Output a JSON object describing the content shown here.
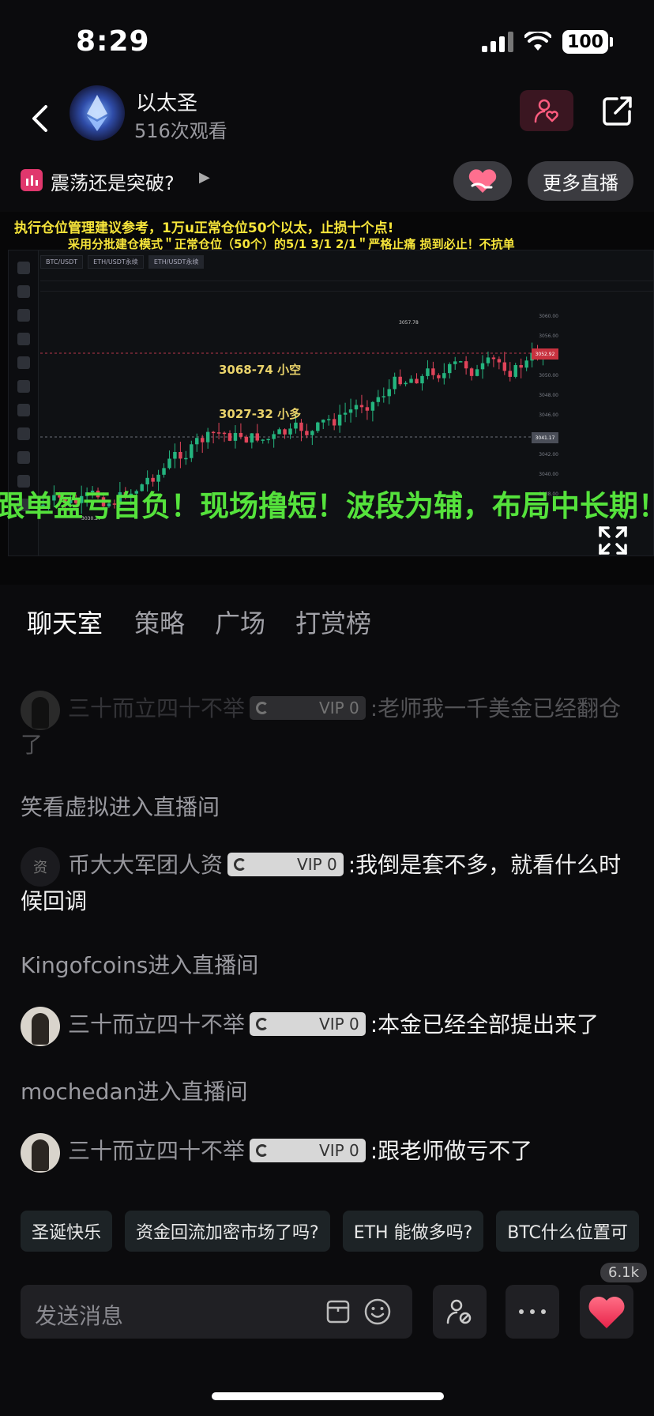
{
  "status": {
    "time": "8:29",
    "battery": "100"
  },
  "header": {
    "title": "以太圣",
    "views": "516次观看"
  },
  "topic": {
    "text": "震荡还是突破?"
  },
  "buttons": {
    "more_live": "更多直播"
  },
  "video": {
    "banner_line1": "执行仓位管理建议参考，1万u正常仓位50个以太，止损十个点!",
    "banner_line2": "采用分批建仓模式＂正常仓位（50个）的5/1   3/1   2/1＂严格止痛 损到必止！不抗单",
    "pairs": [
      "BTC/USDT",
      "ETH/USDT永续",
      "ETH/USDT永续"
    ],
    "label_short": "3068-74 小空",
    "label_long": "3027-32 小多",
    "peak": "3057.78",
    "low": "3030.27",
    "price_tag_red": "3052.92",
    "price_tag_grey": "3041.17",
    "marquee": "跟单盈亏自负！现场撸短！波段为辅，布局中长期！"
  },
  "tabs": [
    "聊天室",
    "策略",
    "广场",
    "打赏榜"
  ],
  "chat": [
    {
      "user": "三十而立四十不举",
      "vip": "VIP 0",
      "text": ":老师我一千美金已经翻仓了",
      "faded": true
    },
    {
      "system": "笑看虚拟进入直播间"
    },
    {
      "user": "币大大军团人资",
      "vip": "VIP 0",
      "text": ":我倒是套不多，就看什么时候回调",
      "avatar_text": "资"
    },
    {
      "system": "Kingofcoins进入直播间"
    },
    {
      "user": "三十而立四十不举",
      "vip": "VIP 0",
      "text": ":本金已经全部提出来了"
    },
    {
      "system": "mochedan进入直播间"
    },
    {
      "user": "三十而立四十不举",
      "vip": "VIP 0",
      "text": ":跟老师做亏不了"
    }
  ],
  "quick_replies": [
    "圣诞快乐",
    "资金回流加密市场了吗?",
    "ETH 能做多吗?",
    "BTC什么位置可"
  ],
  "input": {
    "placeholder": "发送消息"
  },
  "likes": "6.1k",
  "colors": {
    "accent": "#e8345f",
    "vip_bg": "#d7d7d7",
    "marquee": "#55e23c",
    "banner": "#f6e43a"
  }
}
